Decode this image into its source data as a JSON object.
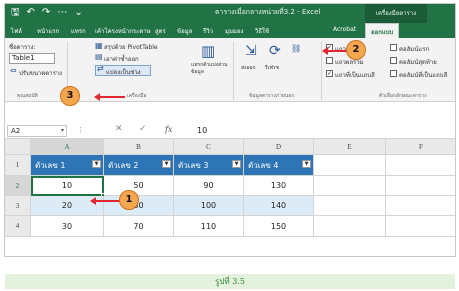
{
  "window": {
    "title": "ตารางเมื่อกลางหน่วยที่3.2 - Excel",
    "context_label": "เครื่องมือตาราง",
    "qat": {
      "save": "🖫",
      "undo": "↶",
      "redo": "↷",
      "more": "⋯",
      "customize": "⌄"
    }
  },
  "tabs": [
    "ไฟล์",
    "หน้าแรก",
    "แทรก",
    "เค้าโครงหน้ากระดาษ",
    "สูตร",
    "ข้อมูล",
    "รีวิว",
    "มุมมอง",
    "วิธีใช้",
    "Acrobat",
    "ออกแบบ"
  ],
  "ribbon": {
    "props_title": "ชื่อตาราง:",
    "table_name": "Table1",
    "resize_label": "ปรับขนาดตาราง",
    "props_group": "คุณสมบัติ",
    "pivot": "สรุปด้วย PivotTable",
    "remove_dup": "เอาค่าซ้ำออก",
    "convert_range": "แปลงเป็นช่วง",
    "tools_group": "เครื่องมือ",
    "slicer": "แทรกตัวแบ่งส่วนข้อมูล",
    "export": "ส่งออก",
    "refresh": "รีเฟรช",
    "ext_group": "ข้อมูลตารางภายนอก",
    "opt_header": "แถวส่วนหัว",
    "opt_total": "แถวผลรวม",
    "opt_banded": "แถวที่เป็นแถบสี",
    "opt_first": "คอลัมน์แรก",
    "opt_last": "คอลัมน์สุดท้าย",
    "opt_bcols": "คอลัมน์ที่เป็นแถบสี",
    "style_group": "ตัวเลือกลักษณะตาราง"
  },
  "formula_bar": {
    "name_box": "A2",
    "fx": "fx",
    "cancel": "✕",
    "enter": "✓",
    "value": "10"
  },
  "sheet": {
    "columns": [
      "A",
      "B",
      "C",
      "D",
      "E",
      "F"
    ],
    "rows": [
      "1",
      "2",
      "3",
      "4"
    ],
    "headers": [
      "ตัวเลข 1",
      "ตัวเลข 2",
      "ตัวเลข 3",
      "ตัวเลข 4"
    ],
    "data": [
      [
        "10",
        "50",
        "90",
        "130"
      ],
      [
        "20",
        "60",
        "100",
        "140"
      ],
      [
        "30",
        "70",
        "110",
        "150"
      ]
    ]
  },
  "callouts": {
    "c1": "1",
    "c2": "2",
    "c3": "3"
  },
  "caption": "รูปที่ 3.5",
  "colors": {
    "excel_green": "#217346",
    "table_header": "#2e75b6",
    "band": "#ddebf7",
    "callout": "#f6a64f",
    "arrow": "#e0262f"
  }
}
